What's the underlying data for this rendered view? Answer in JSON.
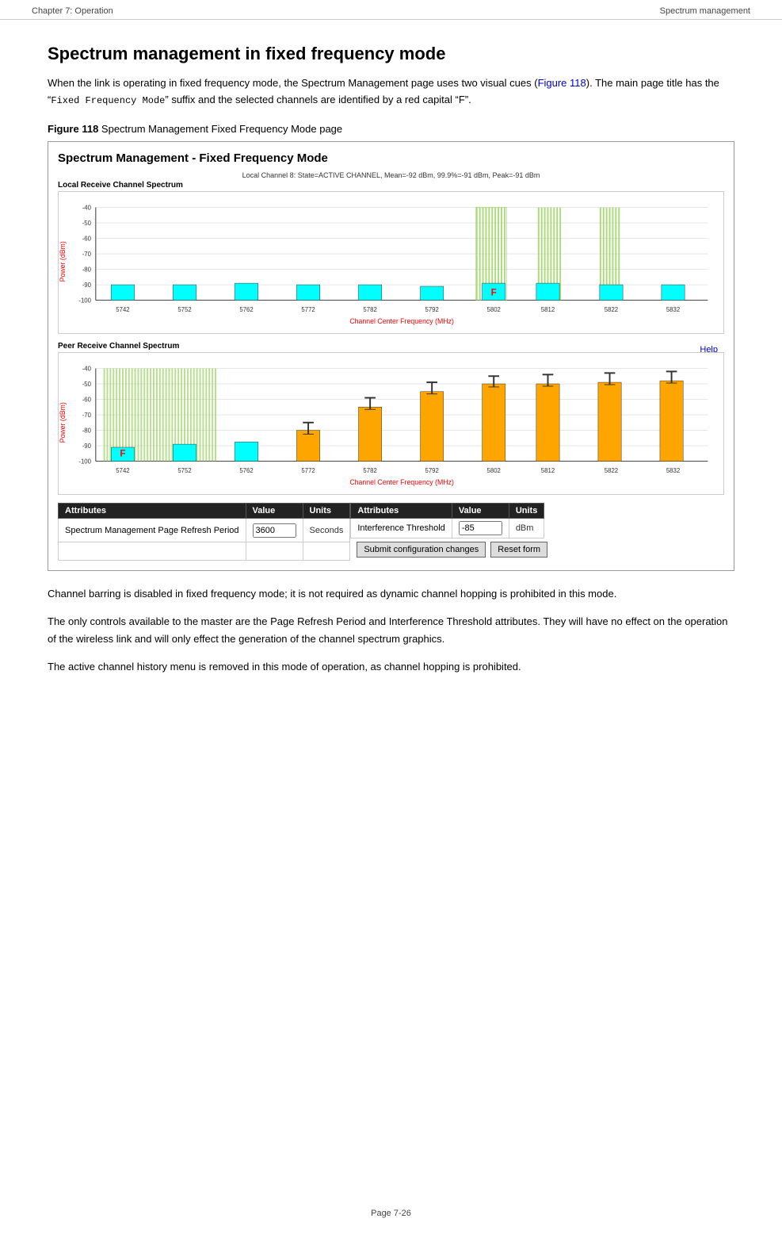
{
  "header": {
    "left": "Chapter 7:  Operation",
    "right": "Spectrum management"
  },
  "title": "Spectrum management in fixed frequency mode",
  "intro": {
    "para1_start": "When the link is operating in fixed frequency mode, the Spectrum Management page uses two visual cues (",
    "link": "Figure 118",
    "para1_end": "). The main page title has the “",
    "code": "Fixed Frequency Mode",
    "para1_end2": "” suffix and the selected channels are identified by a red capital “F”."
  },
  "figure_caption": {
    "label": "Figure 118",
    "text": "  Spectrum Management Fixed Frequency Mode page"
  },
  "spectrum_box": {
    "title": "Spectrum Management - Fixed Frequency Mode",
    "local_chart": {
      "label": "Local Receive Channel Spectrum",
      "info": "Local Channel 8: State=ACTIVE CHANNEL, Mean=-92 dBm, 99.9%=-91 dBm, Peak=-91 dBm",
      "x_label": "Channel Center Frequency (MHz)",
      "y_label": "Power (dBm)",
      "frequencies": [
        "5742",
        "5752",
        "5762",
        "5772",
        "5782",
        "5792",
        "5802",
        "5812",
        "5822",
        "5832"
      ],
      "y_ticks": [
        "-40",
        "-50",
        "-60",
        "-70",
        "-80",
        "-90",
        "-100"
      ]
    },
    "peer_chart": {
      "label": "Peer Receive Channel Spectrum",
      "x_label": "Channel Center Frequency (MHz)",
      "y_label": "Power (dBm)",
      "help_link": "Help",
      "frequencies": [
        "5742",
        "5752",
        "5762",
        "5772",
        "5782",
        "5792",
        "5802",
        "5812",
        "5822",
        "5832"
      ],
      "y_ticks": [
        "-40",
        "-50",
        "-60",
        "-70",
        "-80",
        "-90",
        "-100"
      ]
    },
    "table_left": {
      "headers": [
        "Attributes",
        "Value",
        "Units"
      ],
      "rows": [
        {
          "attr": "Spectrum Management Page Refresh Period",
          "value": "3600",
          "units": "Seconds"
        }
      ]
    },
    "table_right": {
      "headers": [
        "Attributes",
        "Value",
        "Units"
      ],
      "rows": [
        {
          "attr": "Interference Threshold",
          "value": "-85",
          "units": "dBm"
        }
      ],
      "buttons": [
        "Submit configuration changes",
        "Reset form"
      ]
    }
  },
  "body_paragraphs": [
    "Channel barring is disabled in fixed frequency mode; it is not required as dynamic channel hopping is prohibited in this mode.",
    "The only controls available to the master are the Page Refresh Period and Interference Threshold attributes. They will have no effect on the operation of the wireless link and will only effect the generation of the channel spectrum graphics.",
    "The active channel history menu is removed in this mode of operation, as channel hopping is prohibited."
  ],
  "footer": "Page 7-26"
}
